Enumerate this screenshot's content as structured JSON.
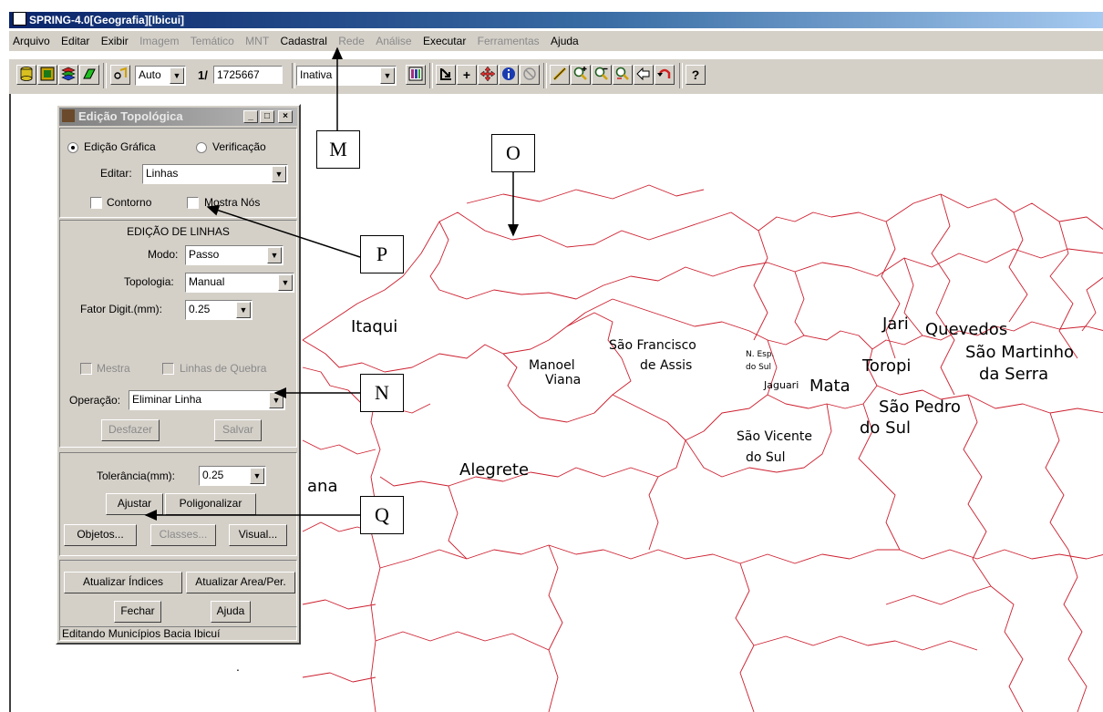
{
  "window": {
    "title": "SPRING-4.0[Geografia][Ibicui]"
  },
  "menu": [
    {
      "label": "Arquivo",
      "enabled": true
    },
    {
      "label": "Editar",
      "enabled": true
    },
    {
      "label": "Exibir",
      "enabled": true
    },
    {
      "label": "Imagem",
      "enabled": false
    },
    {
      "label": "Temático",
      "enabled": false
    },
    {
      "label": "MNT",
      "enabled": false
    },
    {
      "label": "Cadastral",
      "enabled": true
    },
    {
      "label": "Rede",
      "enabled": false
    },
    {
      "label": "Análise",
      "enabled": false
    },
    {
      "label": "Executar",
      "enabled": true
    },
    {
      "label": "Ferramentas",
      "enabled": false
    },
    {
      "label": "Ajuda",
      "enabled": true
    }
  ],
  "toolbar": {
    "zoom_mode": "Auto",
    "scale_prefix": "1/",
    "scale_value": "1725667",
    "state_select": "Inativa",
    "help_glyph": "?"
  },
  "dialog": {
    "title": "Edição Topológica",
    "mode_graphic": "Edição Gráfica",
    "mode_verify": "Verificação",
    "edit_label": "Editar:",
    "edit_value": "Linhas",
    "contour_label": "Contorno",
    "show_nodes_label": "Mostra Nós",
    "section_title": "EDIÇÃO DE LINHAS",
    "mode_label": "Modo:",
    "mode_value": "Passo",
    "topology_label": "Topologia:",
    "topology_value": "Manual",
    "factor_label": "Fator Digit.(mm):",
    "factor_value": "0.25",
    "master_label": "Mestra",
    "breaklines_label": "Linhas de Quebra",
    "operation_label": "Operação:",
    "operation_value": "Eliminar Linha",
    "undo_button": "Desfazer",
    "save_button": "Salvar",
    "tolerance_label": "Tolerância(mm):",
    "tolerance_value": "0.25",
    "adjust_button": "Ajustar",
    "polygonize_button": "Poligonalizar",
    "objects_button": "Objetos...",
    "classes_button": "Classes...",
    "visual_button": "Visual...",
    "update_index_button": "Atualizar Índices",
    "update_area_button": "Atualizar Area/Per.",
    "close_button": "Fechar",
    "help_button": "Ajuda",
    "status": "Editando Municípios  Bacia  Ibicuí"
  },
  "map_labels": {
    "itaqui": "Itaqui",
    "manoel": "Manoel",
    "viana": "Viana",
    "sao_francisco": "São Francisco",
    "de_assis": "de Assis",
    "n_esp": "N. Esp.",
    "do_sul_small": "do Sul",
    "jaguari": "Jaguari",
    "mata": "Mata",
    "jari": "Jari",
    "quevedos": "Quevedos",
    "sao_martinho": "São Martinho",
    "da_serra": "da Serra",
    "toropi": "Toropi",
    "sao_pedro": "São Pedro",
    "do_sul": "do Sul",
    "sao_vicente": "São Vicente",
    "do_sul_vicente": "do Sul",
    "alegrete": "Alegrete",
    "ana": "ana"
  },
  "callouts": {
    "m": "M",
    "o": "O",
    "p": "P",
    "n": "N",
    "q": "Q"
  },
  "colors": {
    "map_lines": "#cc1e2e",
    "title_active": "#0a246a",
    "ui_face": "#d4d0c8"
  }
}
